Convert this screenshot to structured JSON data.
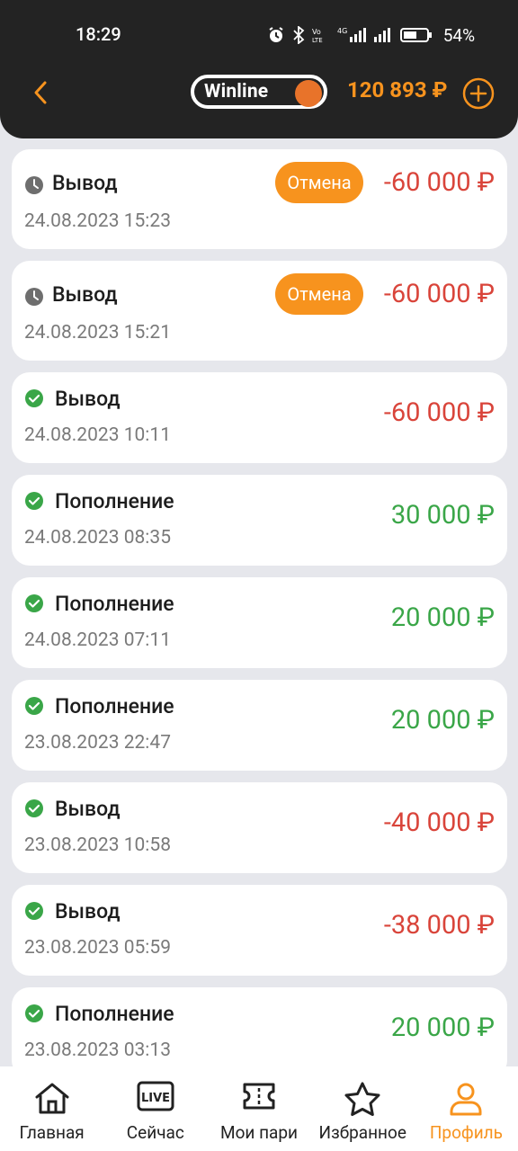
{
  "status_bar": {
    "time": "18:29",
    "battery": "54%"
  },
  "header": {
    "logo_text": "Winline",
    "balance": "120 893 ₽"
  },
  "transactions": [
    {
      "type": "Вывод",
      "date": "24.08.2023 15:23",
      "amount": "-60 000 ₽",
      "status": "pending",
      "action": "Отмена"
    },
    {
      "type": "Вывод",
      "date": "24.08.2023 15:21",
      "amount": "-60 000 ₽",
      "status": "pending",
      "action": "Отмена"
    },
    {
      "type": "Вывод",
      "date": "24.08.2023 10:11",
      "amount": "-60 000 ₽",
      "status": "completed"
    },
    {
      "type": "Пополнение",
      "date": "24.08.2023 08:35",
      "amount": "30 000 ₽",
      "status": "completed"
    },
    {
      "type": "Пополнение",
      "date": "24.08.2023 07:11",
      "amount": "20 000 ₽",
      "status": "completed"
    },
    {
      "type": "Пополнение",
      "date": "23.08.2023 22:47",
      "amount": "20 000 ₽",
      "status": "completed"
    },
    {
      "type": "Вывод",
      "date": "23.08.2023 10:58",
      "amount": "-40 000 ₽",
      "status": "completed"
    },
    {
      "type": "Вывод",
      "date": "23.08.2023 05:59",
      "amount": "-38 000 ₽",
      "status": "completed"
    },
    {
      "type": "Пополнение",
      "date": "23.08.2023 03:13",
      "amount": "20 000 ₽",
      "status": "completed"
    }
  ],
  "bottom_nav": [
    {
      "label": "Главная",
      "icon": "home-icon"
    },
    {
      "label": "Сейчас",
      "icon": "live-icon"
    },
    {
      "label": "Мои пари",
      "icon": "ticket-icon"
    },
    {
      "label": "Избранное",
      "icon": "star-icon"
    },
    {
      "label": "Профиль",
      "icon": "profile-icon",
      "active": true
    }
  ],
  "colors": {
    "accent": "#f7931e",
    "negative": "#d9443a",
    "positive": "#3aa648",
    "header_bg": "#232323"
  }
}
